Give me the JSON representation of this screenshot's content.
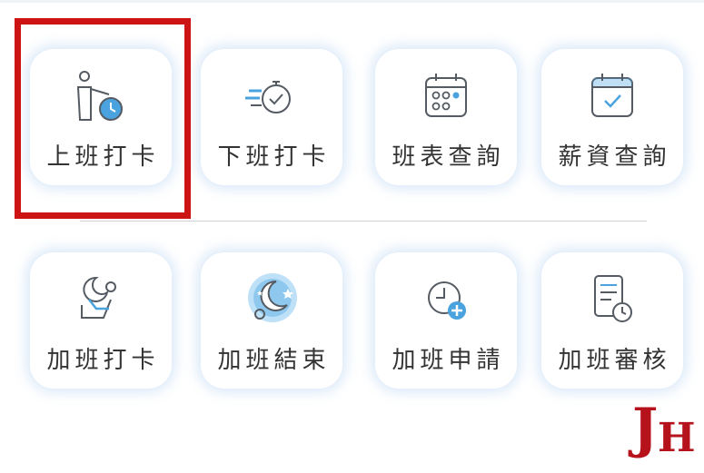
{
  "colors": {
    "highlight": "#cc1414",
    "icon_stroke": "#555b63",
    "icon_accent": "#4aa3df",
    "logo": "#b5121b"
  },
  "row1": [
    {
      "label": "上班打卡",
      "icon": "clock-in-person-icon"
    },
    {
      "label": "下班打卡",
      "icon": "stopwatch-check-icon"
    },
    {
      "label": "班表查詢",
      "icon": "calendar-grid-icon"
    },
    {
      "label": "薪資查詢",
      "icon": "calendar-check-icon"
    }
  ],
  "row2": [
    {
      "label": "加班打卡",
      "icon": "overtime-clock-in-icon"
    },
    {
      "label": "加班結束",
      "icon": "moon-stars-icon"
    },
    {
      "label": "加班申請",
      "icon": "clock-plus-icon"
    },
    {
      "label": "加班審核",
      "icon": "document-clock-icon"
    }
  ],
  "logo": {
    "letter_j": "J",
    "letter_h": "H"
  }
}
